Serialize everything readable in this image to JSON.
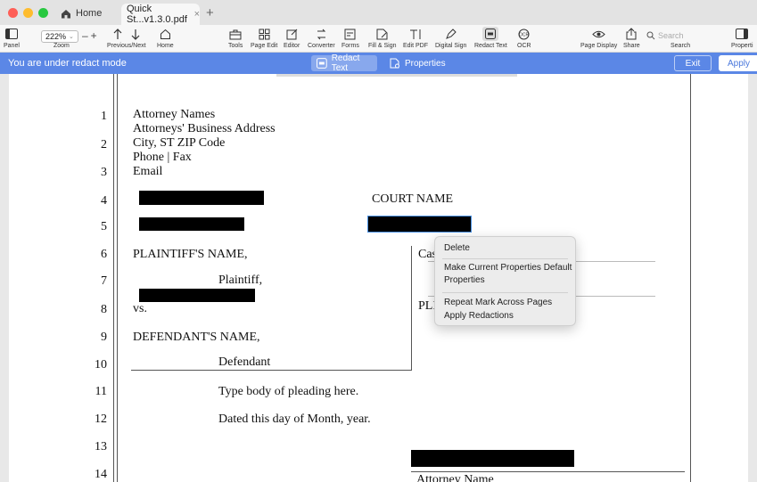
{
  "tabs": {
    "home": "Home",
    "document": "Quick St...v1.3.0.pdf"
  },
  "toolbar": {
    "panel": "Panel",
    "zoom_value": "222%",
    "zoom_label": "Zoom",
    "prevnext": "Previous/Next",
    "home": "Home",
    "tools": "Tools",
    "page_edit": "Page Edit",
    "editor": "Editor",
    "converter": "Converter",
    "forms": "Forms",
    "fill_sign": "Fill & Sign",
    "edit_pdf": "Edit PDF",
    "digital_sign": "Digital Sign",
    "redact_text": "Redact Text",
    "ocr": "OCR",
    "page_display": "Page Display",
    "share": "Share",
    "search_placeholder": "Search",
    "search_label": "Search",
    "properties": "Properti"
  },
  "redact_bar": {
    "message": "You are under redact mode",
    "redact_text": "Redact Text",
    "properties": "Properties",
    "exit": "Exit",
    "apply": "Apply"
  },
  "document": {
    "line_numbers": [
      "1",
      "2",
      "3",
      "4",
      "5",
      "6",
      "7",
      "8",
      "9",
      "10",
      "11",
      "12",
      "13",
      "14"
    ],
    "address": [
      "Attorney Names",
      "Attorneys' Business Address",
      "City, ST ZIP Code",
      "Phone | Fax",
      "Email"
    ],
    "court_name": "COURT NAME",
    "plaintiff_name": "PLAINTIFF'S NAME,",
    "plaintiff": "Plaintiff,",
    "vs": "vs.",
    "defendant_name": "DEFENDANT'S NAME,",
    "defendant": "Defendant",
    "case_partial": "Cas",
    "pl_partial": "PLI",
    "body": "Type body of pleading here.",
    "dated": "Dated this day of Month, year.",
    "attorney_name": "Attorney Name"
  },
  "context_menu": {
    "delete": "Delete",
    "make_default_1": "Make Current Properties Default",
    "make_default_2": "Properties",
    "repeat": "Repeat Mark Across Pages",
    "apply": "Apply Redactions"
  }
}
